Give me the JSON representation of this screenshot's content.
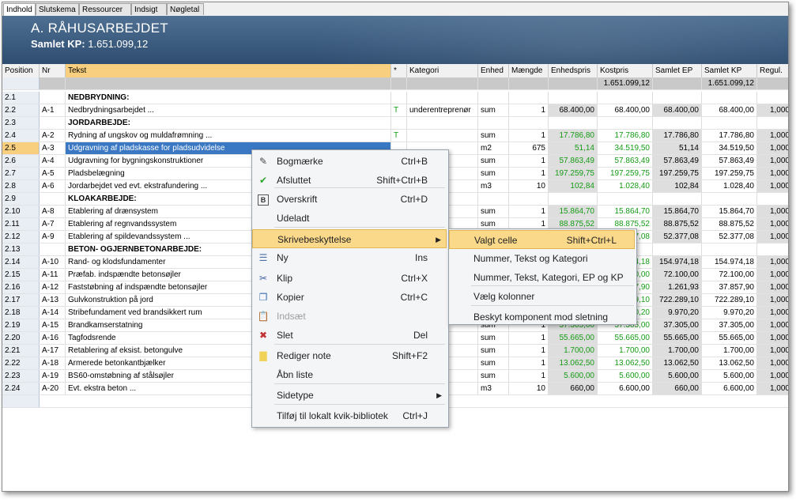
{
  "tabs": [
    "Indhold",
    "Slutskema",
    "Ressourcer",
    "Indsigt",
    "Nøgletal"
  ],
  "header": {
    "title": "A. RÅHUSARBEJDET",
    "sub_label": "Samlet KP:",
    "sub_value": "1.651.099,12"
  },
  "columns": [
    "Position",
    "Nr",
    "Tekst",
    "*",
    "Kategori",
    "Enhed",
    "Mængde",
    "Enhedspris",
    "Kostpris",
    "Samlet EP",
    "Samlet KP",
    "Regul."
  ],
  "summary": {
    "kostpris": "1.651.099,12",
    "samlet_kp": "1.651.099,12"
  },
  "rows": [
    {
      "pos": "2.1",
      "nr": "",
      "tekst": "NEDBRYDNING:",
      "star": "",
      "kat": "",
      "enh": "",
      "mgd": "",
      "ep": "",
      "kp": "",
      "sep": "",
      "skp": "",
      "reg": "",
      "bold": true
    },
    {
      "pos": "2.2",
      "nr": "A-1",
      "tekst": "Nedbrydningsarbejdet ...",
      "star": "T",
      "kat": "underentreprenør",
      "enh": "sum",
      "mgd": "1",
      "ep": "68.400,00",
      "kp": "68.400,00",
      "sep": "68.400,00",
      "skp": "68.400,00",
      "reg": "1,000",
      "green": false
    },
    {
      "pos": "2.3",
      "nr": "",
      "tekst": "JORDARBEJDE:",
      "star": "",
      "kat": "",
      "enh": "",
      "mgd": "",
      "ep": "",
      "kp": "",
      "sep": "",
      "skp": "",
      "reg": "",
      "bold": true
    },
    {
      "pos": "2.4",
      "nr": "A-2",
      "tekst": "Rydning af ungskov og muldafrømning ...",
      "star": "T",
      "kat": "",
      "enh": "sum",
      "mgd": "1",
      "ep": "17.786,80",
      "kp": "17.786,80",
      "sep": "17.786,80",
      "skp": "17.786,80",
      "reg": "1,000",
      "green": true
    },
    {
      "pos": "2.5",
      "nr": "A-3",
      "tekst": "Udgravning af pladskasse for pladsudvidelse",
      "star": "",
      "kat": "",
      "enh": "m2",
      "mgd": "675",
      "ep": "51,14",
      "kp": "34.519,50",
      "sep": "51,14",
      "skp": "34.519,50",
      "reg": "1,000",
      "green": true,
      "selected": true
    },
    {
      "pos": "2.6",
      "nr": "A-4",
      "tekst": "Udgravning for bygningskonstruktioner",
      "star": "",
      "kat": "",
      "enh": "sum",
      "mgd": "1",
      "ep": "57.863,49",
      "kp": "57.863,49",
      "sep": "57.863,49",
      "skp": "57.863,49",
      "reg": "1,000",
      "green": true
    },
    {
      "pos": "2.7",
      "nr": "A-5",
      "tekst": "Pladsbelægning",
      "star": "",
      "kat": "",
      "enh": "sum",
      "mgd": "1",
      "ep": "197.259,75",
      "kp": "197.259,75",
      "sep": "197.259,75",
      "skp": "197.259,75",
      "reg": "1,000",
      "green": true
    },
    {
      "pos": "2.8",
      "nr": "A-6",
      "tekst": "Jordarbejdet ved evt. ekstrafundering ...",
      "star": "",
      "kat": "",
      "enh": "m3",
      "mgd": "10",
      "ep": "102,84",
      "kp": "1.028,40",
      "sep": "102,84",
      "skp": "1.028,40",
      "reg": "1,000",
      "green": true
    },
    {
      "pos": "2.9",
      "nr": "",
      "tekst": "KLOAKARBEJDE:",
      "star": "",
      "kat": "",
      "enh": "",
      "mgd": "",
      "ep": "",
      "kp": "",
      "sep": "",
      "skp": "",
      "reg": "",
      "bold": true
    },
    {
      "pos": "2.10",
      "nr": "A-8",
      "tekst": "Etablering af drænsystem",
      "star": "",
      "kat": "",
      "enh": "sum",
      "mgd": "1",
      "ep": "15.864,70",
      "kp": "15.864,70",
      "sep": "15.864,70",
      "skp": "15.864,70",
      "reg": "1,000",
      "green": true
    },
    {
      "pos": "2.11",
      "nr": "A-7",
      "tekst": "Etablering af regnvandssystem",
      "star": "",
      "kat": "",
      "enh": "sum",
      "mgd": "1",
      "ep": "88.875,52",
      "kp": "88.875,52",
      "sep": "88.875,52",
      "skp": "88.875,52",
      "reg": "1,000",
      "green": true
    },
    {
      "pos": "2.12",
      "nr": "A-9",
      "tekst": "Etablering af spildevandssystem ...",
      "star": "",
      "kat": "",
      "enh": "sum",
      "mgd": "1",
      "ep": "52.377,08",
      "kp": "52.377,08",
      "sep": "52.377,08",
      "skp": "52.377,08",
      "reg": "1,000",
      "green": true
    },
    {
      "pos": "2.13",
      "nr": "",
      "tekst": "BETON- OGJERNBETONARBEJDE:",
      "star": "",
      "kat": "",
      "enh": "",
      "mgd": "",
      "ep": "",
      "kp": "",
      "sep": "",
      "skp": "",
      "reg": "",
      "bold": true
    },
    {
      "pos": "2.14",
      "nr": "A-10",
      "tekst": "Rand- og klodsfundamenter",
      "star": "",
      "kat": "",
      "enh": "sum",
      "mgd": "1",
      "ep": "154.974,18",
      "kp": "154.974,18",
      "sep": "154.974,18",
      "skp": "154.974,18",
      "reg": "1,000",
      "green": true
    },
    {
      "pos": "2.15",
      "nr": "A-11",
      "tekst": "Præfab. indspændte betonsøjler",
      "star": "",
      "kat": "",
      "enh": "sum",
      "mgd": "1",
      "ep": "72.100,00",
      "kp": "72.100,00",
      "sep": "72.100,00",
      "skp": "72.100,00",
      "reg": "1,000",
      "green": true
    },
    {
      "pos": "2.16",
      "nr": "A-12",
      "tekst": "Faststøbning af indspændte betonsøjler",
      "star": "",
      "kat": "",
      "enh": "sum",
      "mgd": "1",
      "ep": "1.261,93",
      "kp": "37.857,90",
      "sep": "1.261,93",
      "skp": "37.857,90",
      "reg": "1,000",
      "green": true
    },
    {
      "pos": "2.17",
      "nr": "A-13",
      "tekst": "Gulvkonstruktion på jord",
      "star": "",
      "kat": "",
      "enh": "sum",
      "mgd": "1",
      "ep": "722.289,10",
      "kp": "722.289,10",
      "sep": "722.289,10",
      "skp": "722.289,10",
      "reg": "1,000",
      "green": true
    },
    {
      "pos": "2.18",
      "nr": "A-14",
      "tekst": "Stribefundament ved brandsikkert rum",
      "star": "",
      "kat": "",
      "enh": "sum",
      "mgd": "1",
      "ep": "9.970,20",
      "kp": "9.970,20",
      "sep": "9.970,20",
      "skp": "9.970,20",
      "reg": "1,000",
      "green": true
    },
    {
      "pos": "2.19",
      "nr": "A-15",
      "tekst": "Brandkamserstatning",
      "star": "",
      "kat": "",
      "enh": "sum",
      "mgd": "1",
      "ep": "37.305,00",
      "kp": "37.305,00",
      "sep": "37.305,00",
      "skp": "37.305,00",
      "reg": "1,000",
      "green": true
    },
    {
      "pos": "2.20",
      "nr": "A-16",
      "tekst": "Tagfodsrende",
      "star": "",
      "kat": "",
      "enh": "sum",
      "mgd": "1",
      "ep": "55.665,00",
      "kp": "55.665,00",
      "sep": "55.665,00",
      "skp": "55.665,00",
      "reg": "1,000",
      "green": true
    },
    {
      "pos": "2.21",
      "nr": "A-17",
      "tekst": "Retablering af eksist. betongulve",
      "star": "",
      "kat": "",
      "enh": "sum",
      "mgd": "1",
      "ep": "1.700,00",
      "kp": "1.700,00",
      "sep": "1.700,00",
      "skp": "1.700,00",
      "reg": "1,000",
      "green": true
    },
    {
      "pos": "2.22",
      "nr": "A-18",
      "tekst": "Armerede betonkantbjælker",
      "star": "",
      "kat": "",
      "enh": "sum",
      "mgd": "1",
      "ep": "13.062,50",
      "kp": "13.062,50",
      "sep": "13.062,50",
      "skp": "13.062,50",
      "reg": "1,000",
      "green": true
    },
    {
      "pos": "2.23",
      "nr": "A-19",
      "tekst": "BS60-omstøbning af stålsøjler",
      "star": "",
      "kat": "",
      "enh": "sum",
      "mgd": "1",
      "ep": "5.600,00",
      "kp": "5.600,00",
      "sep": "5.600,00",
      "skp": "5.600,00",
      "reg": "1,000",
      "green": true
    },
    {
      "pos": "2.24",
      "nr": "A-20",
      "tekst": "Evt. ekstra beton ...",
      "star": "",
      "kat": "",
      "enh": "m3",
      "mgd": "10",
      "ep": "660,00",
      "kp": "6.600,00",
      "sep": "660,00",
      "skp": "6.600,00",
      "reg": "1,000",
      "green": false
    }
  ],
  "context_menu": [
    {
      "label": "Bogmærke",
      "shortcut": "Ctrl+B",
      "icon": "bookmark-icon"
    },
    {
      "label": "Afsluttet",
      "shortcut": "Shift+Ctrl+B",
      "icon": "checkmark-icon"
    },
    {
      "label": "Overskrift",
      "shortcut": "Ctrl+D",
      "icon": "bold-b-icon"
    },
    {
      "label": "Udeladt",
      "shortcut": "",
      "icon": ""
    },
    {
      "label": "Skrivebeskyttelse",
      "shortcut": "",
      "icon": "",
      "submenu": true
    },
    {
      "label": "Ny",
      "shortcut": "Ins",
      "icon": "new-row-icon"
    },
    {
      "label": "Klip",
      "shortcut": "Ctrl+X",
      "icon": "scissors-icon"
    },
    {
      "label": "Kopier",
      "shortcut": "Ctrl+C",
      "icon": "copy-icon"
    },
    {
      "label": "Indsæt",
      "shortcut": "",
      "icon": "paste-icon",
      "disabled": true
    },
    {
      "label": "Slet",
      "shortcut": "Del",
      "icon": "delete-icon"
    },
    {
      "label": "Rediger note",
      "shortcut": "Shift+F2",
      "icon": "note-icon"
    },
    {
      "label": "Åbn liste",
      "shortcut": "",
      "icon": ""
    },
    {
      "label": "Sidetype",
      "shortcut": "",
      "icon": "",
      "submenu": true
    },
    {
      "label": "Tilføj til lokalt kvik-bibliotek",
      "shortcut": "Ctrl+J",
      "icon": ""
    }
  ],
  "submenu": [
    {
      "label": "Valgt celle",
      "shortcut": "Shift+Ctrl+L"
    },
    {
      "label": "Nummer, Tekst og Kategori",
      "shortcut": ""
    },
    {
      "label": "Nummer, Tekst, Kategori, EP og KP",
      "shortcut": ""
    },
    {
      "label": "Vælg kolonner",
      "shortcut": ""
    },
    {
      "label": "Beskyt komponent mod sletning",
      "shortcut": ""
    }
  ]
}
